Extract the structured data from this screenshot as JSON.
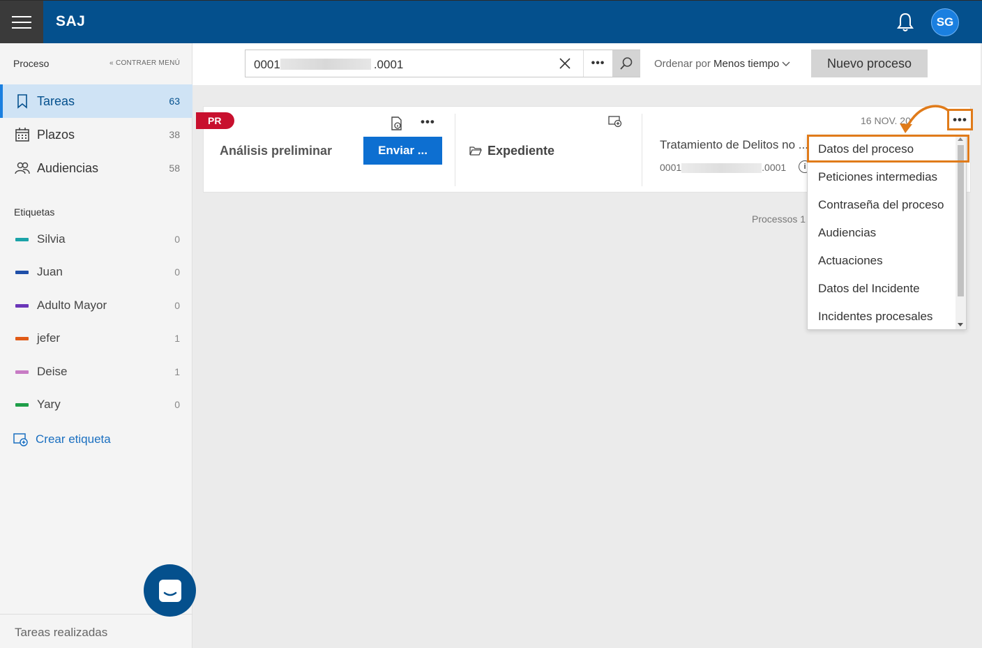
{
  "app": {
    "brand": "SAJ",
    "user_initials": "SG"
  },
  "sidebar": {
    "title": "Proceso",
    "collapse_label": "« CONTRAER MENÚ",
    "nav": [
      {
        "label": "Tareas",
        "count": "63",
        "icon": "bookmark-icon",
        "active": true
      },
      {
        "label": "Plazos",
        "count": "38",
        "icon": "calendar-icon"
      },
      {
        "label": "Audiencias",
        "count": "58",
        "icon": "people-icon"
      }
    ],
    "tags_title": "Etiquetas",
    "tags": [
      {
        "label": "Silvia",
        "count": "0",
        "color": "#1aa3a8"
      },
      {
        "label": "Juan",
        "count": "0",
        "color": "#1f4fa8"
      },
      {
        "label": "Adulto Mayor",
        "count": "0",
        "color": "#6a36b8"
      },
      {
        "label": "jefer",
        "count": "1",
        "color": "#e05a16"
      },
      {
        "label": "Deise",
        "count": "1",
        "color": "#c77bc4"
      },
      {
        "label": "Yary",
        "count": "0",
        "color": "#1e9e48"
      }
    ],
    "create_tag": "Crear etiqueta",
    "done_tasks": "Tareas realizadas"
  },
  "toolbar": {
    "search_value_start": "0001",
    "search_value_end": ".0001",
    "more": "•••",
    "sort_prefix": "Ordenar por",
    "sort_value": "Menos tiempo",
    "new_process": "Nuevo proceso"
  },
  "card": {
    "badge": "PR",
    "phase": "Análisis preliminar",
    "send": "Enviar ...",
    "expediente": "Expediente",
    "process_name": "Tratamiento de Delitos no ...",
    "process_num_start": "0001",
    "process_num_end": ".0001",
    "date": "16 NOV. 20",
    "more": "•••"
  },
  "footer": {
    "processos": "Processos 1"
  },
  "menu": {
    "items": [
      "Datos del proceso",
      "Peticiones intermedias",
      "Contraseña del proceso",
      "Audiencias",
      "Actuaciones",
      "Datos del Incidente",
      "Incidentes procesales"
    ]
  },
  "colors": {
    "header": "#04508d",
    "accent": "#0d6fd1",
    "highlight": "#e07b1a",
    "badge": "#c8102e"
  }
}
